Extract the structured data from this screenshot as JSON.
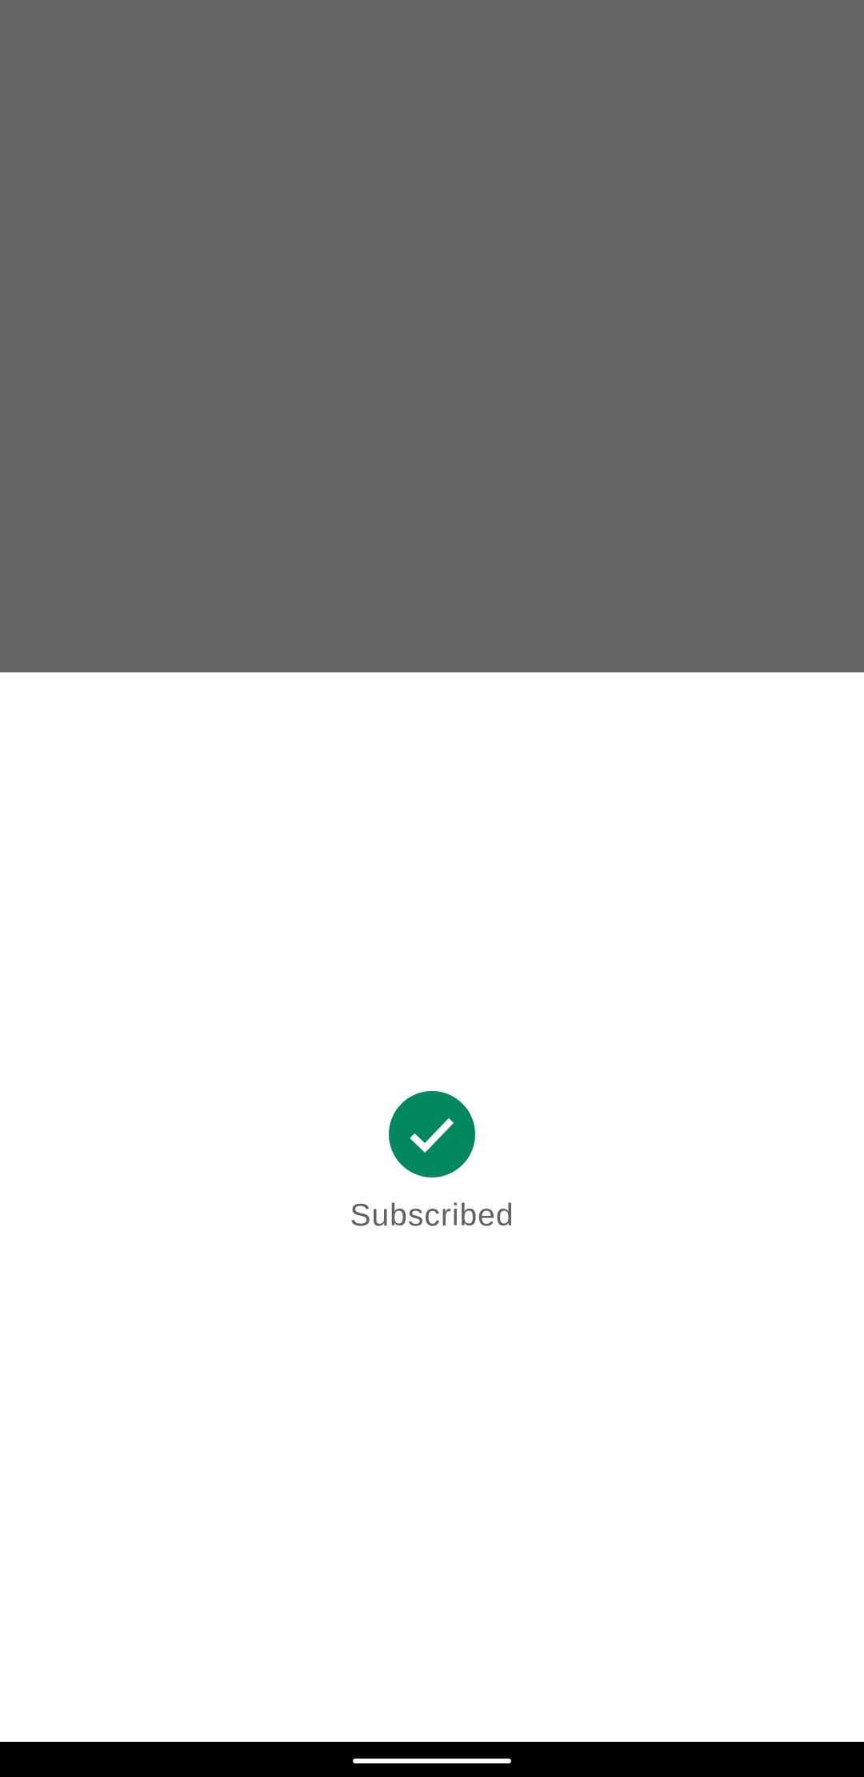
{
  "dialog": {
    "status_label": "Subscribed",
    "icon": "check-circle-icon",
    "accent_color": "#01875f"
  },
  "scrim": {
    "color": "#666666"
  },
  "system": {
    "nav_handle": "home-handle"
  }
}
